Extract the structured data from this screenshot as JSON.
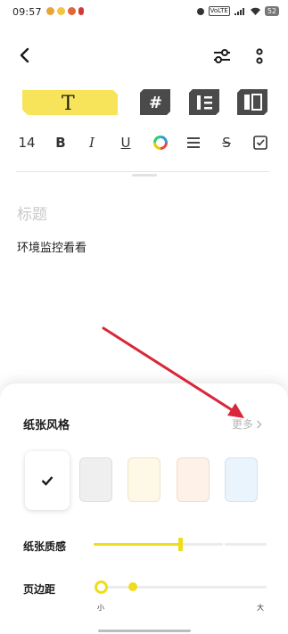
{
  "status_bar": {
    "time": "09:57",
    "battery": "52",
    "network_badges": [
      "VoLTE",
      "5G"
    ]
  },
  "editor": {
    "font_size": "14",
    "bold": "B",
    "italic": "I",
    "underline": "U",
    "strike": "S",
    "text_style_glyph": "T",
    "title_placeholder": "标题",
    "body_text": "环境监控看看"
  },
  "sheet": {
    "paper_style_label": "纸张风格",
    "more_label": "更多",
    "paper_texture_label": "纸张质感",
    "margin_label": "页边距",
    "margin_min_label": "小",
    "margin_max_label": "大",
    "paper_colors": [
      {
        "name": "white",
        "fill": "#ffffff",
        "selected": true
      },
      {
        "name": "gray",
        "fill": "#efefef",
        "border": "#dedede"
      },
      {
        "name": "cream",
        "fill": "#fdf9e6",
        "border": "#ece6c8"
      },
      {
        "name": "peach",
        "fill": "#fdf1e8",
        "border": "#efdcc9"
      },
      {
        "name": "blue",
        "fill": "#eaf4fd",
        "border": "#d2e3f3"
      }
    ],
    "paper_texture_level": 0.5,
    "margin_level": 0.2
  },
  "colors": {
    "accent": "#f0dd1a",
    "arrow": "#d9263a",
    "text": "#1a1a1a",
    "muted": "#b5b5b5"
  }
}
